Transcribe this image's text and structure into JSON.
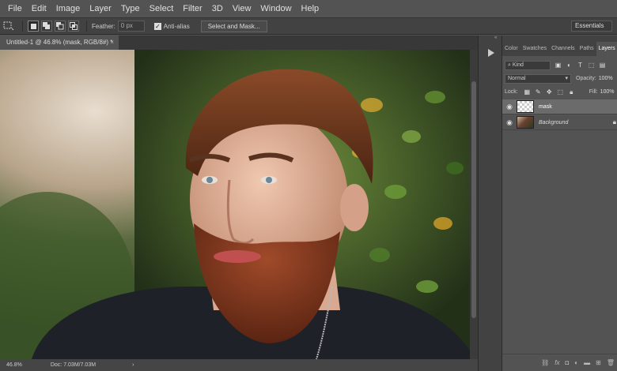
{
  "menu": [
    "File",
    "Edit",
    "Image",
    "Layer",
    "Type",
    "Select",
    "Filter",
    "3D",
    "View",
    "Window",
    "Help"
  ],
  "options": {
    "feather_label": "Feather:",
    "feather_value": "0 px",
    "antialias_label": "Anti-alias",
    "select_mask_label": "Select and Mask...",
    "workspace": "Essentials"
  },
  "document": {
    "tab_title": "Untitled-1 @ 46.8% (mask, RGB/8#) *",
    "close": "×"
  },
  "status": {
    "zoom": "46.8%",
    "doc": "Doc: 7.03M/7.03M",
    "arrow": "›"
  },
  "panel": {
    "tabs": [
      "Color",
      "Swatches",
      "Channels",
      "Paths",
      "Layers"
    ],
    "active_tab": "Layers",
    "kind": "Kind",
    "blend_mode": "Normal",
    "opacity_label": "Opacity:",
    "opacity_value": "100%",
    "lock_label": "Lock:",
    "fill_label": "Fill:",
    "fill_value": "100%",
    "layers": [
      {
        "name": "mask",
        "selected": true
      },
      {
        "name": "Background",
        "selected": false
      }
    ]
  },
  "icons": {
    "play": "play-icon",
    "eye": "eye-icon",
    "lock": "lock-icon"
  }
}
